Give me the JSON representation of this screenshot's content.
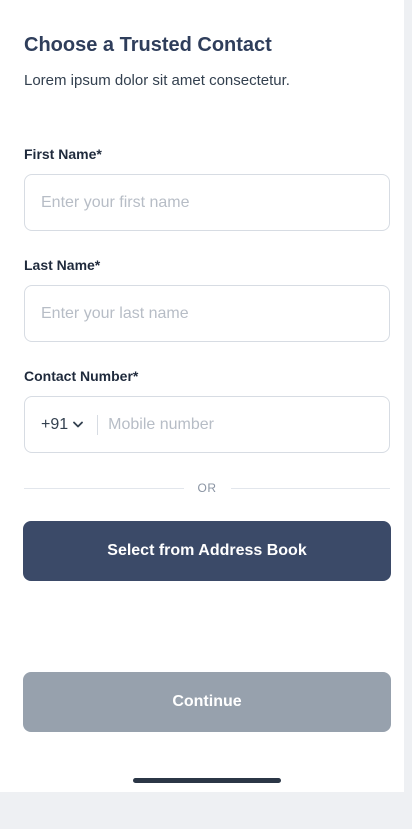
{
  "header": {
    "title": "Choose a Trusted Contact",
    "subtitle": "Lorem ipsum dolor sit amet consectetur."
  },
  "form": {
    "first_name": {
      "label": "First Name*",
      "placeholder": "Enter your first name",
      "value": ""
    },
    "last_name": {
      "label": "Last Name*",
      "placeholder": "Enter your last name",
      "value": ""
    },
    "contact_number": {
      "label": "Contact Number*",
      "country_code": "+91",
      "country_code_icon": "chevron-down-icon",
      "placeholder": "Mobile number",
      "value": ""
    }
  },
  "divider": {
    "text": "OR"
  },
  "actions": {
    "address_book_label": "Select from Address Book",
    "continue_label": "Continue"
  },
  "colors": {
    "title": "#2f3e5b",
    "primary_button": "#3b4a68",
    "disabled_button": "#97a1ad",
    "field_border": "#d7dce3"
  }
}
